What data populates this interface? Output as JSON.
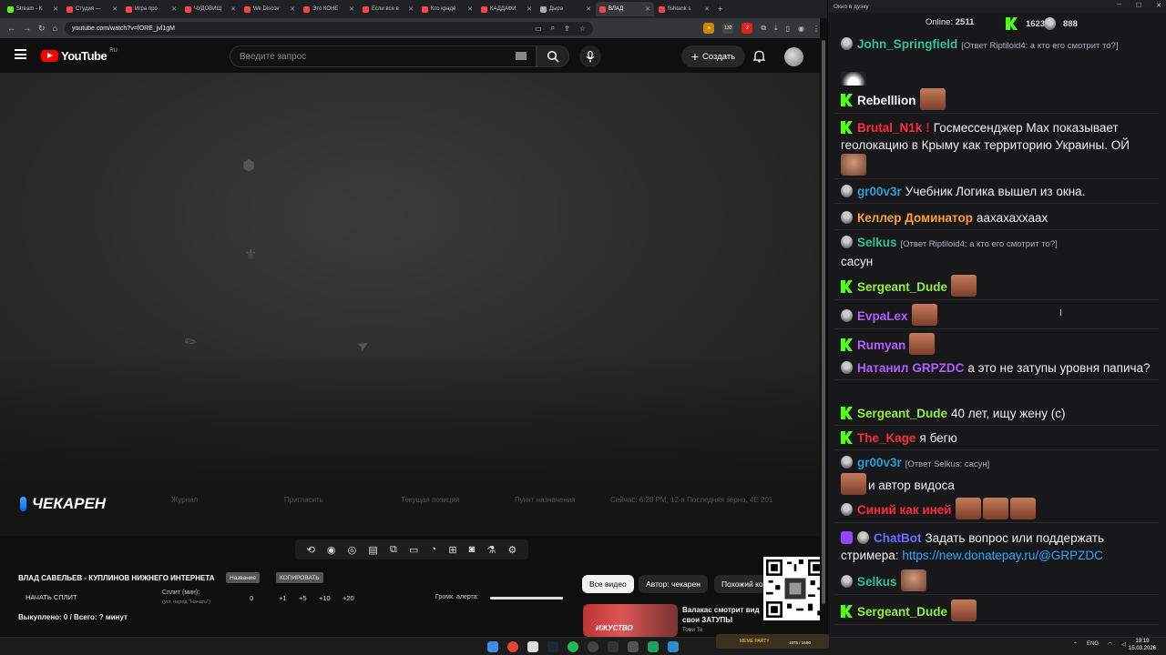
{
  "browser": {
    "tabs": [
      {
        "label": "Stream - K",
        "color": "#53fc18",
        "active": false
      },
      {
        "label": "Студия —",
        "color": "#ff4444",
        "active": false
      },
      {
        "label": "Игра про",
        "color": "#ff4444",
        "active": false
      },
      {
        "label": "ЧУДОВИЩ",
        "color": "#ff4444",
        "active": false
      },
      {
        "label": "We Discov",
        "color": "#ff4444",
        "active": false
      },
      {
        "label": "Это КОНЕ",
        "color": "#ff4444",
        "active": false
      },
      {
        "label": "Если все в",
        "color": "#ff4444",
        "active": false
      },
      {
        "label": "Кто крадё",
        "color": "#ff4444",
        "active": false
      },
      {
        "label": "КАДДАФИ",
        "color": "#ff4444",
        "active": false
      },
      {
        "label": "Дыра",
        "color": "#aaaaaa",
        "active": false
      },
      {
        "label": "ВЛАД",
        "color": "#ff4444",
        "active": true
      },
      {
        "label": "fishtank s",
        "color": "#ff4444",
        "active": false
      }
    ],
    "url": "youtube.com/watch?v=fORE_jvl1gM"
  },
  "youtube": {
    "logo_text": "YouTube",
    "country": "RU",
    "search_placeholder": "Введите запрос",
    "create_label": "Создать"
  },
  "video": {
    "brand": "ЧЕКАРЕН",
    "hud": [
      "Журнал",
      "Пригласить",
      "Текущая позиция",
      "Пункт назначения",
      "Сейчас: 6:28 PM, 12-я Последняя зерно, 4E 201"
    ]
  },
  "panel": {
    "title": "ВЛАД САВЕЛЬЕВ - КУПЛИНОВ НИЖНЕГО ИНТЕРНЕТА",
    "chip1": "Название",
    "chip2": "КОПИРОВАТЬ",
    "split_button": "НАЧАТЬ СПЛИТ",
    "split_label": "Сплит (мин):",
    "split_sub": "(уст. перед \"Начать\")",
    "split_value": "0",
    "steps": [
      "+1",
      "+5",
      "+10",
      "+20"
    ],
    "volume_label": "Громк. алерта:",
    "bought": "Выкуплено: 0 / Всего: ? минут"
  },
  "rec": {
    "chips": [
      "Все видео",
      "Автор: чекарен",
      "Похожий ко"
    ],
    "title": "Валакас смотрит вид свои ЗАТУПЫ",
    "author": "Томи Те",
    "thumb_text": "ИЖУСТВО"
  },
  "chat": {
    "window_title": "Окно в дуэку",
    "online_label": "Online:",
    "online": "2511",
    "kick_count": "1623",
    "twitch_count": "888",
    "messages": [
      {
        "platform": "twitch",
        "user": "John_Springfield",
        "color": "#2fc28e",
        "reply": "[Ответ Riptiloid4: а кто его смотрит то?]",
        "text": ""
      },
      {
        "platform": "kick",
        "user": "Rebelllion",
        "color": "#f1f1f1",
        "text": ""
      },
      {
        "platform": "kick",
        "user": "Brutal_N1k",
        "color": "#ff2a3f",
        "alert": "!",
        "text": "Госмессенджер Max показывает геолокацию в Крыму как территорию Украины. ОЙ"
      },
      {
        "platform": "twitch",
        "user": "gr00v3r",
        "color": "#2b9bd6",
        "text": "Учебник Логика вышел из окна."
      },
      {
        "platform": "twitch",
        "user": "Келлер Доминатор",
        "color": "#ff9f2e",
        "text": "аахахаххаах"
      },
      {
        "platform": "twitch",
        "user": "Selkus",
        "color": "#2fc28e",
        "reply": "[Ответ Riptiloid4: а кто его смотрит то?]",
        "text": "сасун"
      },
      {
        "platform": "kick",
        "user": "Sergeant_Dude",
        "color": "#8ef23c",
        "text": ""
      },
      {
        "platform": "twitch",
        "user": "EvpaLex",
        "color": "#b35cff",
        "text": ""
      },
      {
        "platform": "kick",
        "user": "Rumyan",
        "color": "#b35cff",
        "text": ""
      },
      {
        "platform": "twitch",
        "user": "Натанил",
        "color": "#b35cff",
        "user2": "GRPZDC",
        "text": "а это не затупы уровня папича?"
      },
      {
        "platform": "kick",
        "user": "Sergeant_Dude",
        "color": "#8ef23c",
        "text": "40 лет, ищу жену (с)"
      },
      {
        "platform": "kick",
        "user": "The_Kage",
        "color": "#ff2a3f",
        "text": "я бегю"
      },
      {
        "platform": "twitch",
        "user": "gr00v3r",
        "color": "#2b9bd6",
        "reply": "[Ответ Selkus: сасун]",
        "text": "и автор видоса"
      },
      {
        "platform": "twitch",
        "user": "Синий как иней",
        "color": "#ff2a3f",
        "text": ""
      },
      {
        "platform": "chatbot",
        "user": "ChatBot",
        "color": "#6b6bff",
        "text": "Задать вопрос или поддержать стримера:",
        "link": "https://new.donatepay.ru/@GRPZDC"
      },
      {
        "platform": "twitch",
        "user": "Selkus",
        "color": "#2fc28e",
        "text": ""
      },
      {
        "platform": "kick",
        "user": "Sergeant_Dude",
        "color": "#8ef23c",
        "text": ""
      }
    ]
  },
  "taskbar": {
    "meme_party": "MEME PARTY",
    "meme_count": "1075 / 1500",
    "lang": "ENG",
    "time": "19:19",
    "date": "15.03.2026"
  }
}
